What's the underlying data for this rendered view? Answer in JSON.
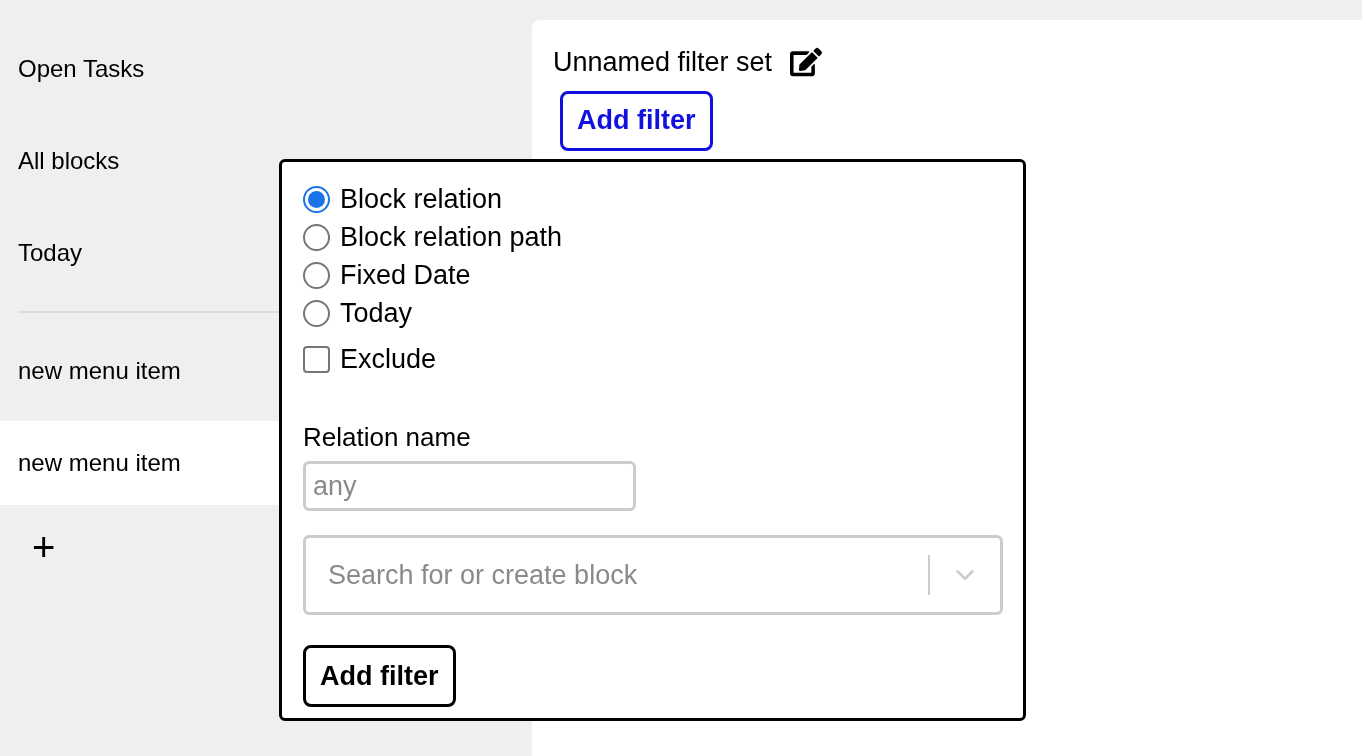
{
  "sidebar": {
    "items": [
      {
        "label": "Open Tasks",
        "selected": false
      },
      {
        "label": "All blocks",
        "selected": false
      },
      {
        "label": "Today",
        "selected": false
      }
    ],
    "custom_items": [
      {
        "label": "new menu item",
        "selected": false
      },
      {
        "label": "new menu item",
        "selected": true
      }
    ],
    "add_label": "+"
  },
  "filter_set": {
    "title": "Unnamed filter set",
    "add_button": "Add filter"
  },
  "popup": {
    "filter_types": [
      {
        "label": "Block relation",
        "selected": true
      },
      {
        "label": "Block relation path",
        "selected": false
      },
      {
        "label": "Fixed Date",
        "selected": false
      },
      {
        "label": "Today",
        "selected": false
      }
    ],
    "exclude": {
      "label": "Exclude",
      "checked": false
    },
    "relation_name": {
      "label": "Relation name",
      "placeholder": "any"
    },
    "block_select": {
      "placeholder": "Search for or create block"
    },
    "submit": "Add filter"
  }
}
